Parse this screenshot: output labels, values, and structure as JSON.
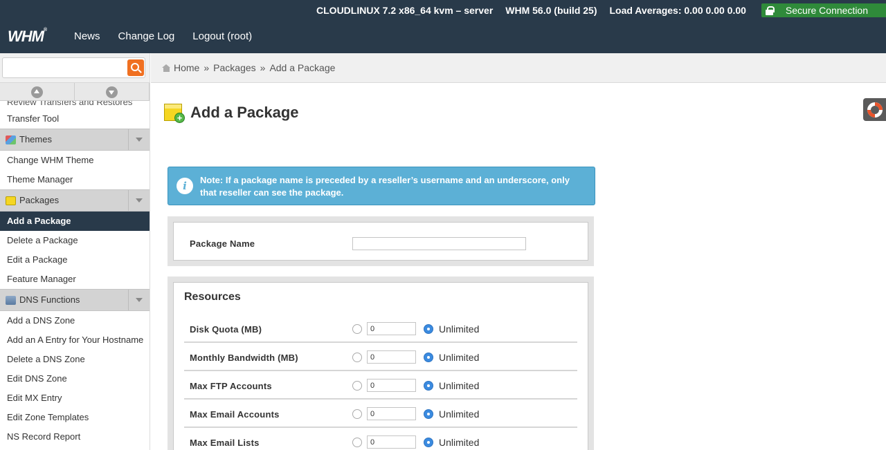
{
  "header": {
    "server_info": "CLOUDLINUX 7.2 x86_64 kvm – server",
    "version": "WHM 56.0 (build 25)",
    "load_averages": "Load Averages: 0.00 0.00 0.00",
    "secure_label": "Secure Connection",
    "logo": "WHM",
    "nav": {
      "news": "News",
      "changelog": "Change Log",
      "logout": "Logout (root)"
    }
  },
  "sidebar": {
    "search_value": "",
    "cut_item": "Review Transfers and Restores",
    "items_top": [
      "Transfer Tool"
    ],
    "themes": {
      "label": "Themes",
      "items": [
        "Change WHM Theme",
        "Theme Manager"
      ]
    },
    "packages": {
      "label": "Packages",
      "active": "Add a Package",
      "items": [
        "Delete a Package",
        "Edit a Package",
        "Feature Manager"
      ]
    },
    "dns": {
      "label": "DNS Functions",
      "items": [
        "Add a DNS Zone",
        "Add an A Entry for Your Hostname",
        "Delete a DNS Zone",
        "Edit DNS Zone",
        "Edit MX Entry",
        "Edit Zone Templates",
        "NS Record Report"
      ]
    }
  },
  "breadcrumb": {
    "home": "Home",
    "sep": "»",
    "packages": "Packages",
    "current": "Add a Package"
  },
  "main": {
    "title": "Add a Package",
    "note": "Note: If a package name is preceded by a reseller’s username and an underscore, only that reseller can see the package.",
    "info_glyph": "i",
    "package_name_label": "Package Name",
    "package_name_value": "",
    "resources_title": "Resources",
    "unlimited_label": "Unlimited",
    "resources": [
      {
        "label": "Disk Quota (MB)",
        "value": "0"
      },
      {
        "label": "Monthly Bandwidth (MB)",
        "value": "0"
      },
      {
        "label": "Max FTP Accounts",
        "value": "0"
      },
      {
        "label": "Max Email Accounts",
        "value": "0"
      },
      {
        "label": "Max Email Lists",
        "value": "0"
      }
    ]
  },
  "colors": {
    "header_bg": "#293a4a",
    "secure_bg": "#2f8a3a",
    "note_bg": "#5cb0d6",
    "active_bg": "#293a4a",
    "search_btn": "#f07021"
  },
  "icons": [
    "lock-icon",
    "search-icon",
    "scroll-up-icon",
    "scroll-down-icon",
    "themes-icon",
    "packages-icon",
    "dns-icon",
    "chevron-down-icon",
    "home-icon",
    "add-package-icon",
    "info-icon",
    "help-icon"
  ]
}
